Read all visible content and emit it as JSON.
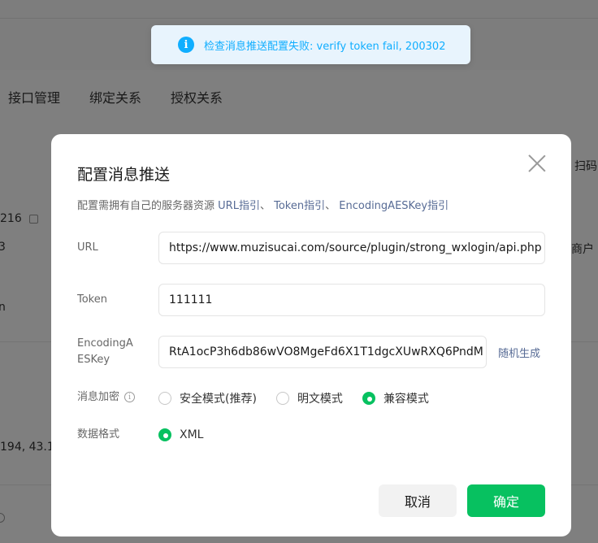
{
  "toast": {
    "icon": "info-icon",
    "message": "检查消息推送配置失败: verify token fail, 200302"
  },
  "background": {
    "tabs": [
      "接口管理",
      "绑定关系",
      "授权关系"
    ],
    "fragments": {
      "number": "216",
      "digit": "3",
      "letter": "n",
      "ip": "194, 43.1",
      "scan": "扫码",
      "merchant": "商户"
    }
  },
  "dialog": {
    "title": "配置消息推送",
    "close_icon": "close-icon",
    "description": {
      "prefix": "配置需拥有自己的服务器资源",
      "links": [
        "URL指引",
        "Token指引",
        "EncodingAESKey指引"
      ],
      "separator": "、"
    },
    "url": {
      "label": "URL",
      "value": "https://www.muzisucai.com/source/plugin/strong_wxlogin/api.php"
    },
    "token": {
      "label": "Token",
      "value": "111111"
    },
    "aes": {
      "label_line1": "EncodingA",
      "label_line2": "ESKey",
      "value": "RtA1ocP3h6db86wVO8MgeFd6X1T1dgcXUwRXQ6PndM",
      "random_label": "随机生成"
    },
    "encryption": {
      "label": "消息加密",
      "options": [
        "安全模式(推荐)",
        "明文模式",
        "兼容模式"
      ],
      "selected": "兼容模式"
    },
    "format": {
      "label": "数据格式",
      "options": [
        "XML"
      ],
      "selected": "XML"
    },
    "buttons": {
      "cancel": "取消",
      "confirm": "确定"
    }
  },
  "colors": {
    "accent": "#07c160",
    "link": "#576b95",
    "info": "#10aeff"
  }
}
